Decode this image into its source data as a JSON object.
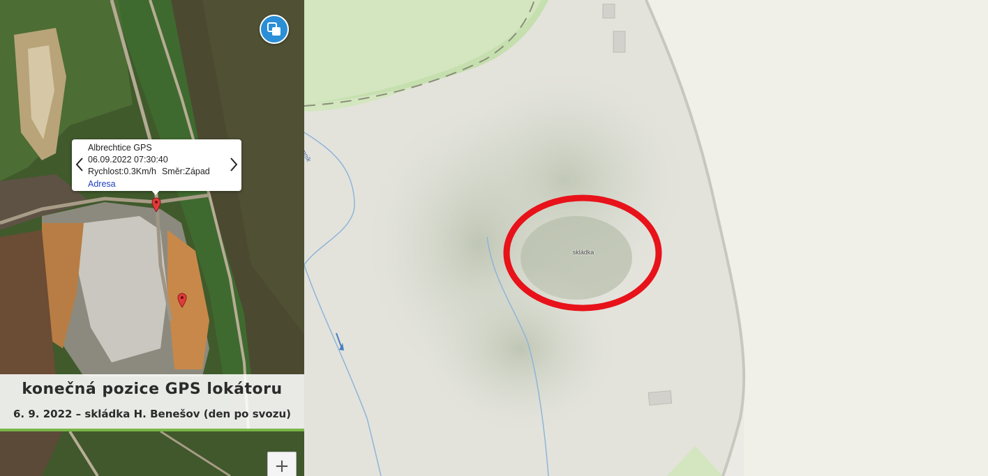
{
  "popup": {
    "device": "Albrechtice GPS",
    "datetime": "06.09.2022 07:30:40",
    "speed": "Rychlost:0.3Km/h",
    "direction": "Směr:Západ",
    "address_link": "Adresa"
  },
  "caption": {
    "title": "konečná pozice GPS lokátoru",
    "subtitle": "6. 9. 2022 – skládka H. Benešov (den po svozu)"
  },
  "map": {
    "area_label": "skládka",
    "stream_label": "mník",
    "highlight_color": "#e8121a"
  },
  "controls": {
    "zoom_in": "+",
    "layers_icon": "layers-switch-icon"
  },
  "colors": {
    "accent_bar": "#7ab648",
    "layers_button": "#2a8fd6",
    "marker": "#e03b3b"
  }
}
